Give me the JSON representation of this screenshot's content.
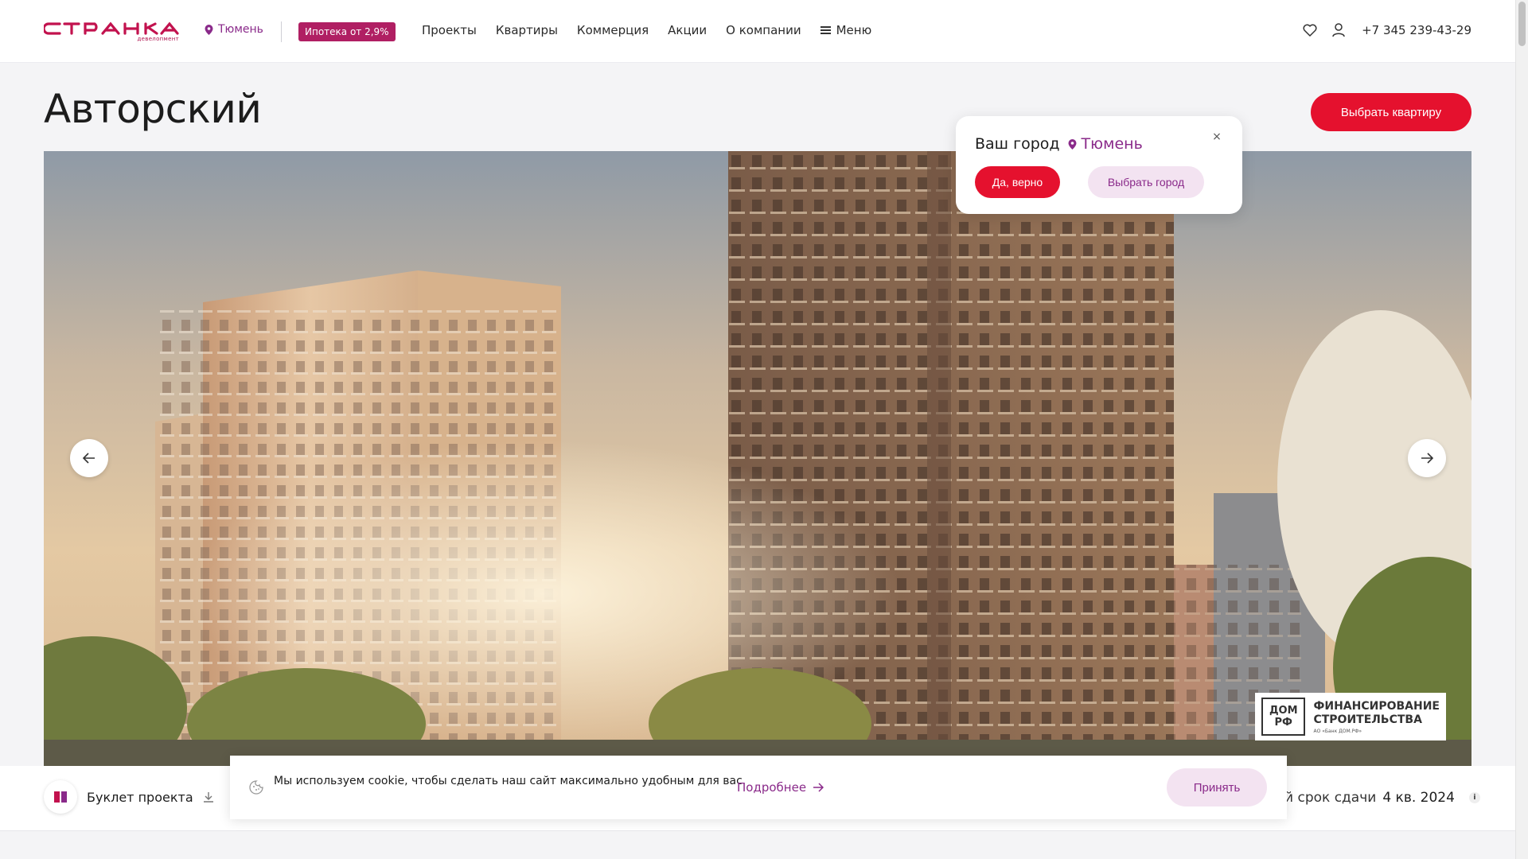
{
  "header": {
    "logo_subtitle": "девелопмент",
    "city": "Тюмень",
    "promo": "Ипотека от 2,9%",
    "nav": [
      "Проекты",
      "Квартиры",
      "Коммерция",
      "Акции",
      "О компании"
    ],
    "menu": "Меню",
    "phone": "+7 345 239-43-29"
  },
  "title": "Авторский",
  "cta": "Выбрать квартиру",
  "hero": {
    "domrf_logo_top": "ДОМ",
    "domrf_logo_bottom": "РФ",
    "domrf_title_1": "ФИНАНСИРОВАНИЕ",
    "domrf_title_2": "СТРОИТЕЛЬСТВА",
    "domrf_small": "АО «Банк ДОМ.РФ»"
  },
  "bottom": {
    "booklet": "Буклет проекта",
    "deadline_label": "ий срок сдачи",
    "deadline_value": "4 кв. 2024",
    "info": "i"
  },
  "cookie": {
    "text": "Мы используем cookie, чтобы сделать наш сайт максимально удобным для вас",
    "more": "Подробнее",
    "accept": "Принять"
  },
  "city_popup": {
    "question": "Ваш город",
    "city": "Тюмень",
    "yes": "Да, верно",
    "choose": "Выбрать город",
    "close": "×"
  },
  "colors": {
    "brand_red": "#e5112e",
    "brand_purple": "#8a2a8a",
    "promo": "#b01f63",
    "light_purple": "#f3e3f1"
  }
}
